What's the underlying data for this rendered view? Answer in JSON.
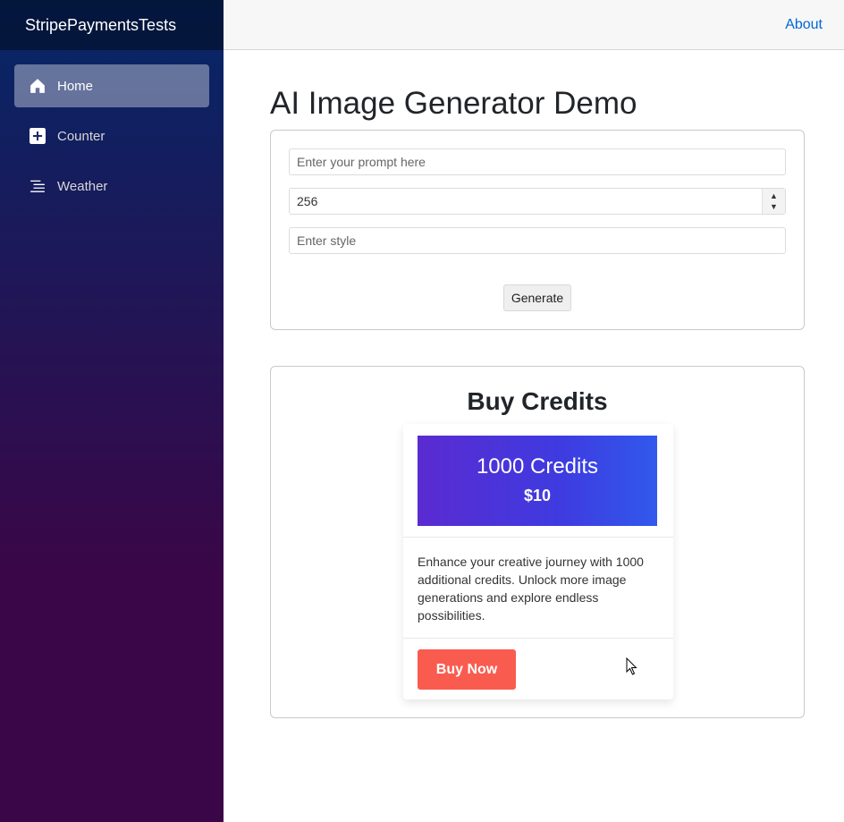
{
  "app": {
    "brand": "StripePaymentsTests"
  },
  "nav": {
    "items": [
      {
        "label": "Home",
        "icon": "home-icon",
        "active": true
      },
      {
        "label": "Counter",
        "icon": "plus-icon",
        "active": false
      },
      {
        "label": "Weather",
        "icon": "list-icon",
        "active": false
      }
    ]
  },
  "topbar": {
    "about_label": "About"
  },
  "page": {
    "title": "AI Image Generator Demo"
  },
  "generator": {
    "prompt_placeholder": "Enter your prompt here",
    "size_value": "256",
    "style_placeholder": "Enter style",
    "generate_label": "Generate"
  },
  "credits": {
    "title": "Buy Credits",
    "product": {
      "name": "1000 Credits",
      "price": "$10",
      "description": "Enhance your creative journey with 1000 additional credits. Unlock more image generations and explore endless possibilities.",
      "buy_label": "Buy Now"
    }
  },
  "colors": {
    "sidebar_top": "#052767",
    "sidebar_bottom": "#3a0647",
    "accent_link": "#0366d6",
    "buy_button": "#f95c4f",
    "banner_start": "#5a2bd1",
    "banner_end": "#3159ec"
  }
}
